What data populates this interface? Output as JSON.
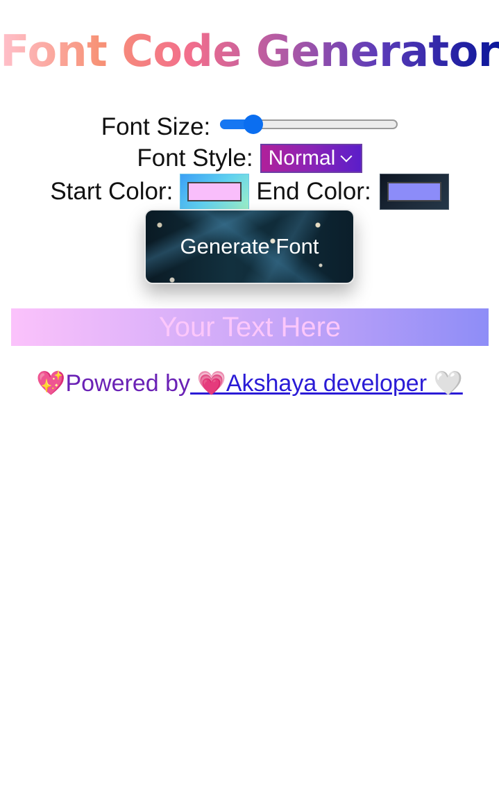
{
  "title": "Font Code Generator",
  "controls": {
    "font_size_label": "Font Size:",
    "font_size_value": 0.15,
    "font_style_label": "Font Style:",
    "font_style_value": "Normal",
    "start_color_label": "Start Color:",
    "start_color_value": "#f9befb",
    "end_color_label": "End Color:",
    "end_color_value": "#8c8cf9"
  },
  "generate_button": {
    "label": "Generate Font"
  },
  "preview": {
    "text": "Your Text Here",
    "gradient_start": "#fbc2fb",
    "gradient_end": "#8e8df7"
  },
  "footer": {
    "prefix": "💖Powered by",
    "link_text": " 💗Akshaya developer 🤍"
  },
  "colors": {
    "accent_blue": "#0b6ef0",
    "select_gradient_start": "#b0209a",
    "select_gradient_end": "#5b1ec9",
    "footer_text": "#6a21b5",
    "footer_link": "#2a1bd6"
  }
}
